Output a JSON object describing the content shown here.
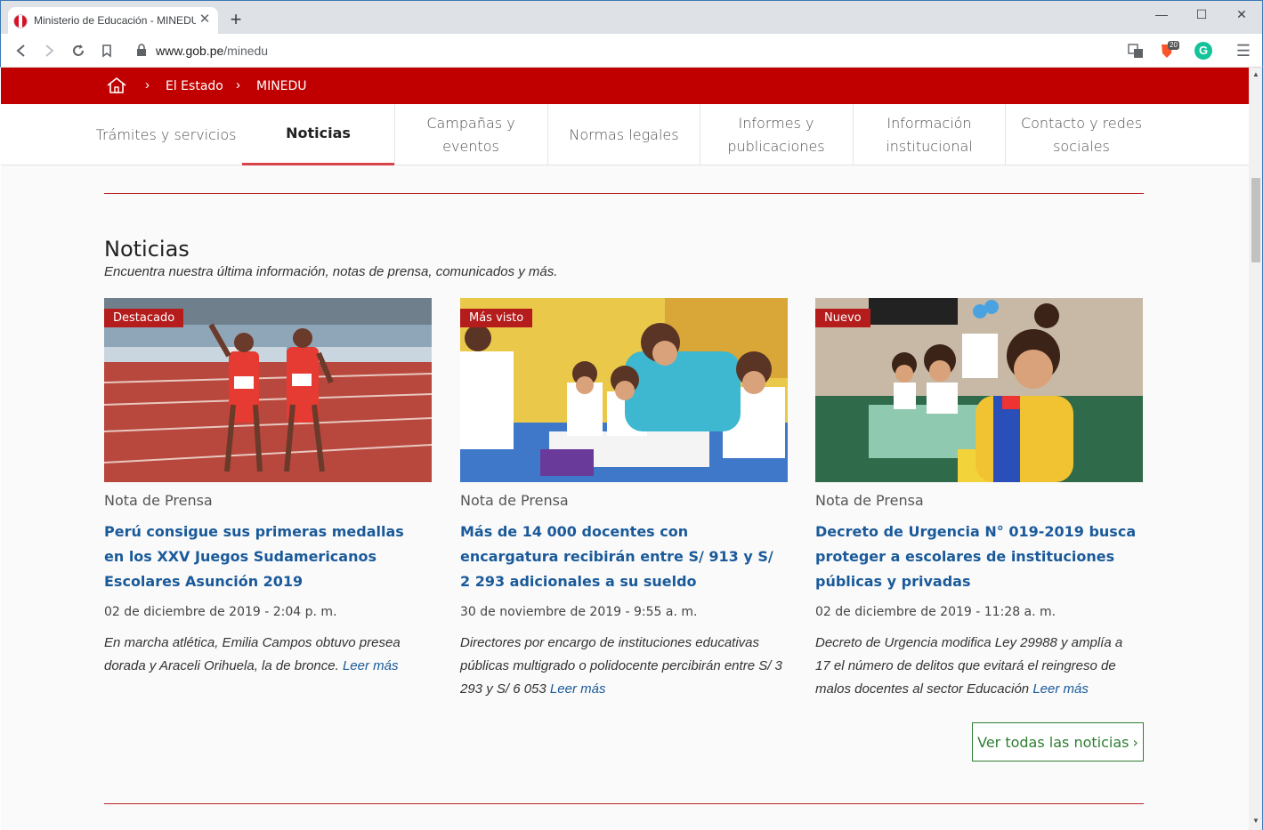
{
  "browser": {
    "tab_title": "Ministerio de Educación - MINEDU",
    "url_host": "www.gob.pe",
    "url_path": "/minedu",
    "ext_badge": "20"
  },
  "breadcrumb": {
    "items": [
      "El Estado",
      "MINEDU"
    ]
  },
  "nav": {
    "items": [
      {
        "label": "Trámites y servicios"
      },
      {
        "label": "Noticias"
      },
      {
        "label": "Campañas y eventos"
      },
      {
        "label": "Normas legales"
      },
      {
        "label": "Informes y publicaciones"
      },
      {
        "label": "Información institucional"
      },
      {
        "label": "Contacto y redes sociales"
      }
    ],
    "active": "Noticias"
  },
  "section": {
    "title": "Noticias",
    "subtitle": "Encuentra nuestra última información, notas de prensa, comunicados y más."
  },
  "cards": [
    {
      "badge": "Destacado",
      "type": "Nota de Prensa",
      "headline": "Perú consigue sus primeras medallas en los XXV Juegos Sudamericanos Escolares Asunción 2019",
      "date": "02 de diciembre de 2019 - 2:04 p. m.",
      "excerpt": "En marcha atlética, Emilia Campos obtuvo presea dorada y Araceli Orihuela, la de bronce.",
      "more": "Leer más"
    },
    {
      "badge": "Más visto",
      "type": "Nota de Prensa",
      "headline": "Más de 14 000 docentes con encargatura recibirán entre S/ 913 y S/ 2 293 adicionales a su sueldo",
      "date": "30 de noviembre de 2019 - 9:55 a. m.",
      "excerpt": "Directores por encargo de instituciones educativas públicas multigrado o polidocente percibirán entre S/ 3 293 y S/ 6 053",
      "more": "Leer más"
    },
    {
      "badge": "Nuevo",
      "type": "Nota de Prensa",
      "headline": "Decreto de Urgencia N° 019-2019 busca proteger a escolares de instituciones públicas y privadas",
      "date": "02 de diciembre de 2019 - 11:28 a. m.",
      "excerpt": "Decreto de Urgencia modifica Ley 29988 y amplía a 17 el número de delitos que evitará el reingreso de malos docentes al sector Educación",
      "more": "Leer más"
    }
  ],
  "see_all": "Ver todas las noticias",
  "colors": {
    "brand_red": "#c00000",
    "link_blue": "#1a5a9a",
    "button_green": "#2e7d32"
  }
}
